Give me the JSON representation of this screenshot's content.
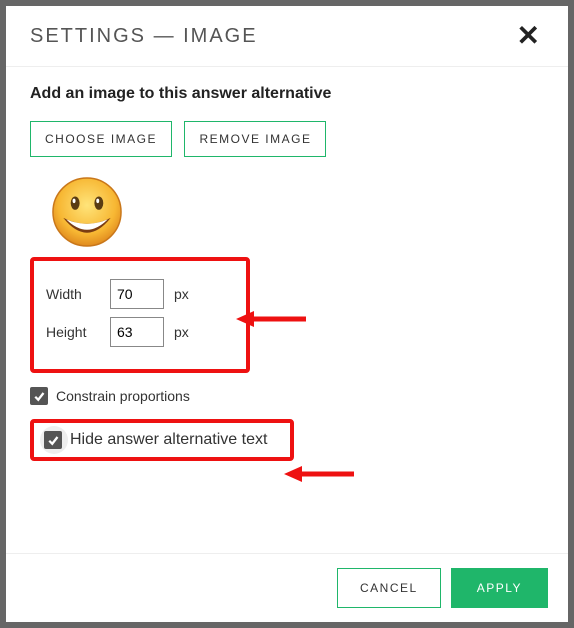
{
  "modal": {
    "title": "SETTINGS — IMAGE",
    "subtitle": "Add an image to this answer alternative",
    "choose_label": "CHOOSE IMAGE",
    "remove_label": "REMOVE IMAGE",
    "width_label": "Width",
    "height_label": "Height",
    "width_value": "70",
    "height_value": "63",
    "unit": "px",
    "constrain_label": "Constrain proportions",
    "constrain_checked": true,
    "hide_label": "Hide answer alternative text",
    "hide_checked": true,
    "cancel_label": "CANCEL",
    "apply_label": "APPLY"
  },
  "annotations": {
    "highlight_size_box": true,
    "highlight_hide_box": true,
    "arrow_to_size": true,
    "arrow_to_hide": true
  }
}
